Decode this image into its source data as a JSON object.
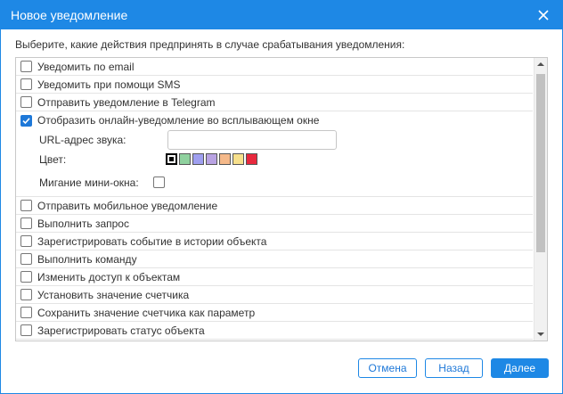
{
  "dialog": {
    "title": "Новое уведомление",
    "instructions": "Выберите, какие действия предпринять в случае срабатывания уведомления:"
  },
  "actions_before": [
    {
      "label": "Уведомить по email",
      "checked": false
    },
    {
      "label": "Уведомить при помощи SMS",
      "checked": false
    },
    {
      "label": "Отправить уведомление в Telegram",
      "checked": false
    }
  ],
  "popup_action": {
    "label": "Отобразить онлайн-уведомление во всплывающем окне",
    "checked": true,
    "sound_url_label": "URL-адрес звука:",
    "sound_url_value": "",
    "color_label": "Цвет:",
    "colors": [
      "#000000",
      "#8fd19e",
      "#9f9ff0",
      "#b9a3e3",
      "#f5b98a",
      "#f7e08c",
      "#e8293e"
    ],
    "selected_color": "#000000",
    "blink_label": "Мигание мини-окна:",
    "blink_checked": false
  },
  "actions_after": [
    {
      "label": "Отправить мобильное уведомление",
      "checked": false
    },
    {
      "label": "Выполнить запрос",
      "checked": false
    },
    {
      "label": "Зарегистрировать событие в истории объекта",
      "checked": false
    },
    {
      "label": "Выполнить команду",
      "checked": false
    },
    {
      "label": "Изменить доступ к объектам",
      "checked": false
    },
    {
      "label": "Установить значение счетчика",
      "checked": false
    },
    {
      "label": "Сохранить значение счетчика как параметр",
      "checked": false
    },
    {
      "label": "Зарегистрировать статус объекта",
      "checked": false
    }
  ],
  "footer": {
    "cancel_label": "Отмена",
    "back_label": "Назад",
    "next_label": "Далее"
  },
  "icons": {
    "close": "close-icon",
    "check": "check-icon",
    "scroll_up": "arrow-up-icon",
    "scroll_down": "arrow-down-icon"
  },
  "colors": {
    "accent": "#1e88e5",
    "border": "#c8c8c8"
  }
}
